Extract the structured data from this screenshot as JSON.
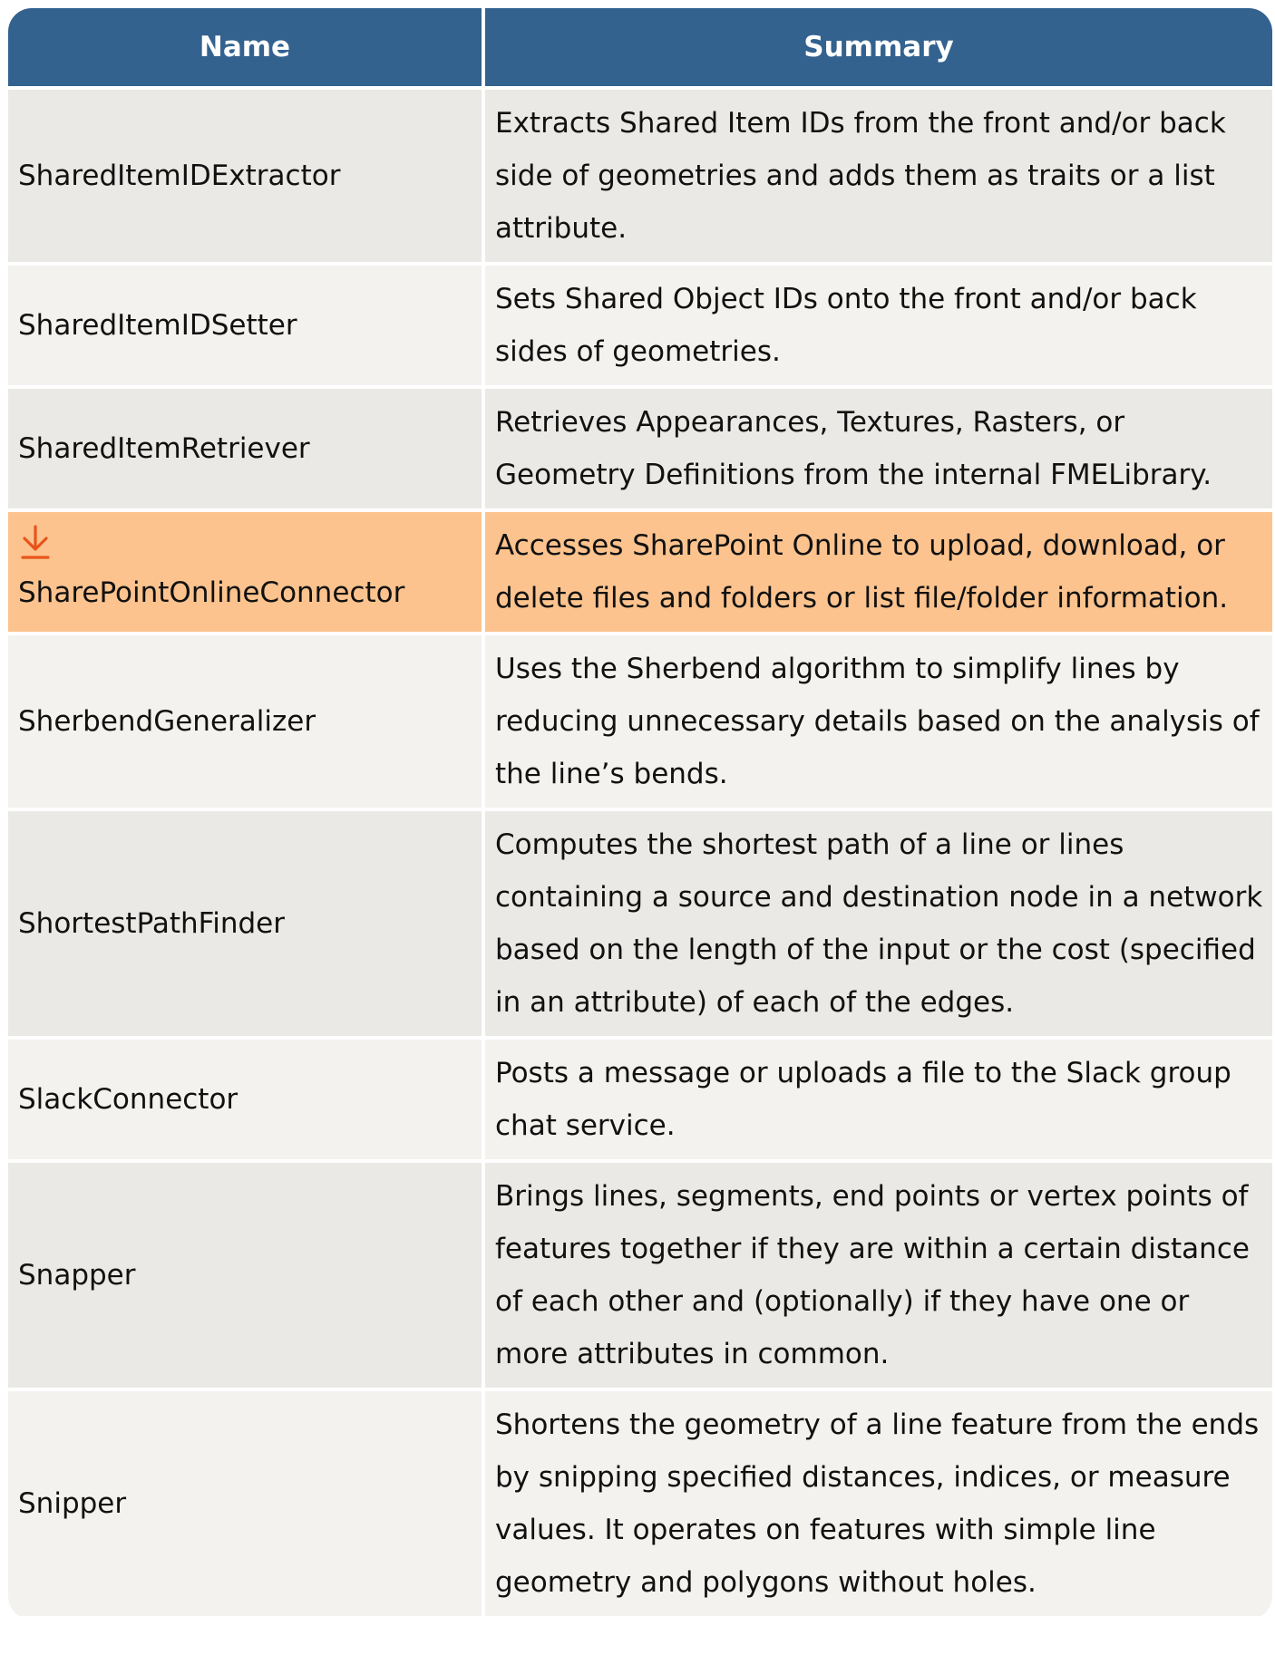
{
  "table": {
    "headers": {
      "name": "Name",
      "summary": "Summary"
    },
    "rows": [
      {
        "name": "SharedItemIDExtractor",
        "summary": "Extracts Shared Item IDs from the front and/or back side of geometries and adds them as traits or a list attribute."
      },
      {
        "name": "SharedItemIDSetter",
        "summary": "Sets Shared Object IDs onto the front and/or back sides of geometries."
      },
      {
        "name": "SharedItemRetriever",
        "summary": "Retrieves Appearances, Textures, Rasters, or Geometry Definitions from the internal FMELibrary."
      },
      {
        "name": "SharePointOnlineConnector",
        "summary": "Accesses SharePoint Online to upload, download, or delete files and folders or list file/folder information.",
        "icon": "download-icon",
        "highlighted": true
      },
      {
        "name": "SherbendGeneralizer",
        "summary": "Uses the Sherbend algorithm to simplify lines by reducing unnecessary details based on the analysis of the line’s bends."
      },
      {
        "name": "ShortestPathFinder",
        "summary": "Computes the shortest path of a line or lines containing a source and destination node in a network based on the length of the input or the cost (specified in an attribute) of each of the edges."
      },
      {
        "name": "SlackConnector",
        "summary": "Posts a message or uploads a file to the Slack group chat service."
      },
      {
        "name": "Snapper",
        "summary": "Brings lines, segments, end points or vertex points of features together if they are within a certain distance of each other and (optionally) if they have one or more attributes in common."
      },
      {
        "name": "Snipper",
        "summary": "Shortens the geometry of a line feature from the ends by snipping specified distances, indices, or measure values. It operates on features with simple line geometry and polygons without holes."
      }
    ]
  },
  "colors": {
    "header_bg": "#33628f",
    "row_odd": "#ebe9e5",
    "row_even": "#f3f2ee",
    "row_highlight": "#fcc38e",
    "icon": "#e8541c"
  }
}
